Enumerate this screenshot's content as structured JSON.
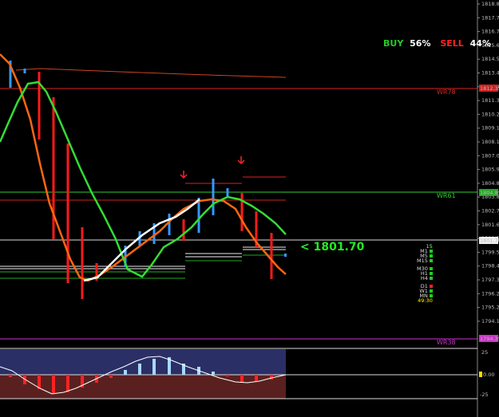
{
  "sentiment": {
    "buy_label": "BUY",
    "buy_pct": "56%",
    "sell_label": "SELL",
    "sell_pct": "44%",
    "buy_color": "#22cc22",
    "sell_color": "#ff2222"
  },
  "price_callout": "<  1801.70",
  "levels": {
    "wr78": "WR78",
    "wr61": "WR61",
    "wr38": "WR38"
  },
  "price_axis": {
    "ticks": [
      "1818.85",
      "1817.75",
      "1816.70",
      "1815.60",
      "1814.55",
      "1813.45",
      "1812.40",
      "1811.30",
      "1810.25",
      "1809.15",
      "1808.10",
      "1807.00",
      "1805.95",
      "1804.85",
      "1803.80",
      "1802.70",
      "1801.65",
      "1800.55",
      "1799.50",
      "1798.40",
      "1797.35",
      "1796.25",
      "1795.20",
      "1794.10"
    ],
    "tag_top": "1812.33",
    "tag_wr61": "1804.85",
    "tag_current": "1801.70",
    "tag_wr38": "1794.35"
  },
  "osc_axis": {
    "ticks": [
      "25",
      "0.00",
      "-25"
    ]
  },
  "timeframes": {
    "top": "15",
    "group1": [
      "M1",
      "M5",
      "M15"
    ],
    "group2": [
      "M30",
      "H1",
      "H4"
    ],
    "group3": [
      "D1",
      "W1",
      "MN"
    ],
    "countdown": "49:30",
    "colors": {
      "green": "#22cc22",
      "red": "#ee2222"
    },
    "group1_status": [
      "green",
      "green",
      "green"
    ],
    "group2_status": [
      "green",
      "green",
      "green"
    ],
    "group3_status": [
      "red",
      "green",
      "green"
    ]
  },
  "colors": {
    "bg": "#000000",
    "bull_bar": "#3399ff",
    "bear_bar": "#ff1a1a",
    "ma_orange": "#ff6611",
    "ma_green": "#33dd33",
    "ma_white": "#ffffff",
    "wr78_color": "#dd2222",
    "wr61_color": "#33cc33",
    "wr38_color": "#cc33cc",
    "osc_pos_bg": "#2a2f66",
    "osc_neg_bg": "#5a2020"
  }
}
